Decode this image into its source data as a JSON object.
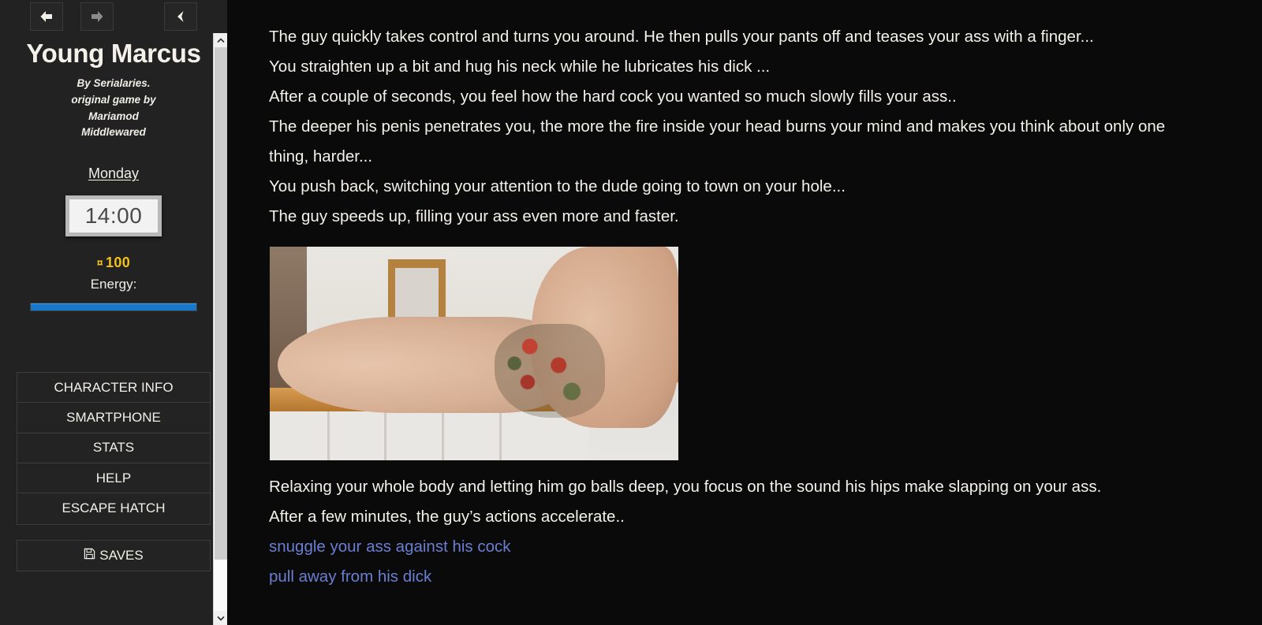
{
  "sidebar": {
    "nav": {
      "back_icon": "arrow-left-icon",
      "forward_icon": "arrow-right-icon",
      "collapse_icon": "chevron-left-icon"
    },
    "title": "Young Marcus",
    "credits_lines": [
      "By Serialaries.",
      "original game by",
      "Mariamod",
      "Middlewared"
    ],
    "day": "Monday",
    "clock": "14:00",
    "money": {
      "icon": "currency-icon",
      "glyph": "¤",
      "value": "100",
      "color": "#f2c21a"
    },
    "energy": {
      "label": "Energy:",
      "percent": 100,
      "color": "#1877c9"
    },
    "menu_primary": [
      {
        "label": "CHARACTER INFO",
        "name": "menu-item-character-info"
      },
      {
        "label": "SMARTPHONE",
        "name": "menu-item-smartphone"
      },
      {
        "label": "STATS",
        "name": "menu-item-stats"
      },
      {
        "label": "HELP",
        "name": "menu-item-help"
      },
      {
        "label": "ESCAPE HATCH",
        "name": "menu-item-escape-hatch"
      }
    ],
    "menu_secondary": [
      {
        "label": "SAVES",
        "icon_glyph": "💾",
        "icon_name": "floppy-disk-icon",
        "name": "menu-item-saves"
      }
    ],
    "scrollbar": {
      "up_arrow": "chevron-up-icon",
      "down_arrow": "chevron-down-icon"
    }
  },
  "main": {
    "paragraphs": [
      "The guy quickly takes control and turns you around. He then pulls your pants off and teases your ass with a finger...",
      "You straighten up a bit and hug his neck while he lubricates his dick ...",
      "After a couple of seconds, you feel how the hard cock you wanted so much slowly fills your ass..",
      "The deeper his penis penetrates you, the more the fire inside your head burns your mind and makes you think about only one thing, harder...",
      "You push back, switching your attention to the dude going to town on your hole...",
      "The guy speeds up, filling your ass even more and faster."
    ],
    "image": {
      "name": "story-illustration",
      "alt": "scene illustration"
    },
    "paragraphs_after": [
      "Relaxing your whole body and letting him go balls deep, you focus on the sound his hips make slapping on your ass.",
      "After a few minutes, the guy’s actions accelerate.."
    ],
    "choices": [
      "snuggle your ass against his cock",
      "pull away from his dick"
    ],
    "link_color": "#6a7fd1"
  }
}
